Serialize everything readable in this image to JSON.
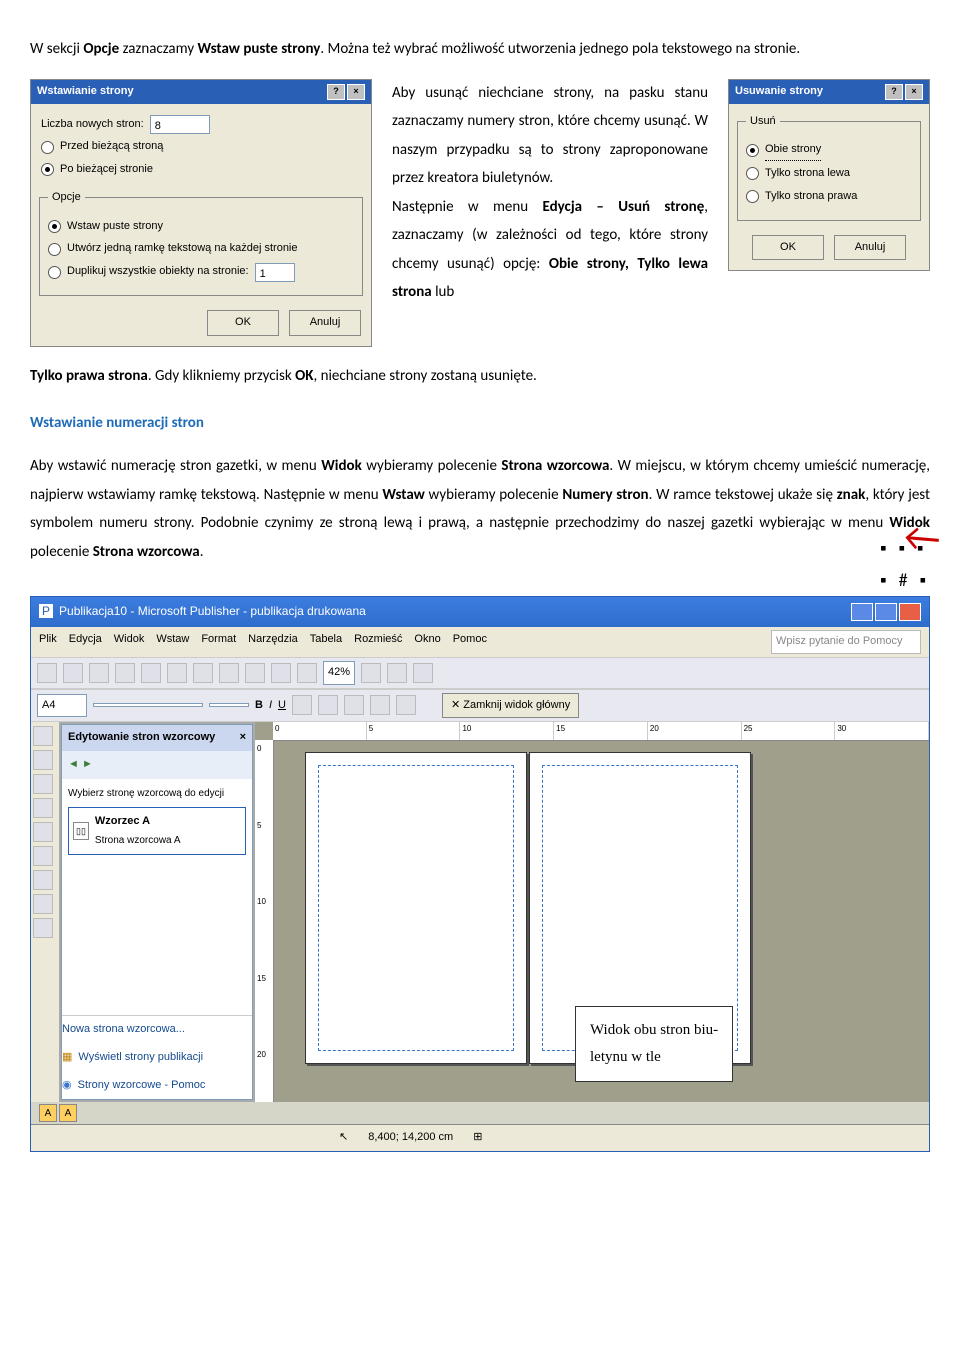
{
  "intro": {
    "p1a": "W sekcji ",
    "p1b": "Opcje",
    "p1c": " zaznaczamy ",
    "p1d": "Wstaw puste strony",
    "p1e": ". Można też wybrać możliwość utworzenia jednego pola tekstowego na stronie."
  },
  "dialog_insert": {
    "title": "Wstawianie strony",
    "field_count": "Liczba nowych stron:",
    "count_value": "8",
    "r_before": "Przed bieżącą stroną",
    "r_after": "Po bieżącej stronie",
    "opt_legend": "Opcje",
    "opt_blank": "Wstaw puste strony",
    "opt_frame": "Utwórz jedną ramkę tekstową na każdej stronie",
    "opt_dup": "Duplikuj wszystkie obiekty na stronie:",
    "dup_value": "1",
    "ok": "OK",
    "cancel": "Anuluj"
  },
  "dialog_delete": {
    "title": "Usuwanie strony",
    "legend": "Usuń",
    "r_both": "Obie strony",
    "r_left": "Tylko strona lewa",
    "r_right": "Tylko strona prawa",
    "ok": "OK",
    "cancel": "Anuluj"
  },
  "middle": {
    "t1": "Aby usunąć niechciane strony, na pasku stanu zaznaczamy numery stron, które chcemy usunąć. W naszym przypadku są to strony zaproponowane przez kreatora biuletynów.",
    "t2a": "Następnie w menu ",
    "t2b": "Edycja – Usuń stronę",
    "t2c": ", zaznaczamy (w zależności od tego, które strony chcemy usunąć) opcję: ",
    "t2d": "Obie strony, Tylko lewa strona ",
    "t2e": "lub "
  },
  "after": {
    "p1a": "Tylko prawa strona",
    "p1b": ". Gdy klikniemy przycisk ",
    "p1c": "OK",
    "p1d": ", niechciane strony zostaną usunięte."
  },
  "section2": {
    "heading": "Wstawianie numeracji stron",
    "p1a": "Aby wstawić numerację stron gazetki, w menu ",
    "p1b": "Widok",
    "p1c": " wybieramy polecenie ",
    "p1d": "Strona wzorcowa",
    "p1e": ". W miejscu, w którym chcemy umieścić numerację, najpierw wstawiamy ramkę tekstową. Następnie w menu ",
    "p1f": "Wstaw",
    "p1g": " wybieramy polecenie ",
    "p1h": "Numery stron",
    "p1i": ". W ramce tekstowej ukaże się ",
    "p1j": "znak",
    "p1k": ", który jest symbolem numeru strony. Podobnie czynimy ze stroną lewą i prawą, a następnie przechodzimy do naszej gazetki wybierając w menu ",
    "p1l": "Widok",
    "p1m": " polecenie ",
    "p1n": "Strona wzorcowa",
    "p1o": "."
  },
  "app": {
    "title": "Publikacja10 - Microsoft Publisher - publikacja drukowana",
    "menu": [
      "Plik",
      "Edycja",
      "Widok",
      "Wstaw",
      "Format",
      "Narzędzia",
      "Tabela",
      "Rozmieść",
      "Okno",
      "Pomoc"
    ],
    "search_placeholder": "Wpisz pytanie do Pomocy",
    "zoom": "42%",
    "close_master": "Zamknij widok główny",
    "pane_title": "Edytowanie stron wzorcowy",
    "pane_label": "Wybierz stronę wzorcową do edycji",
    "pane_item_title": "Wzorzec A",
    "pane_item_sub": "Strona wzorcowa A",
    "pane_new": "Nowa strona wzorcowa...",
    "pane_show": "Wyświetl strony publikacji",
    "pane_help": "Strony wzorcowe - Pomoc",
    "ruler_marks": [
      "0",
      "5",
      "10",
      "15",
      "20",
      "25",
      "30"
    ],
    "ruler_v_marks": [
      "0",
      "5",
      "10",
      "15",
      "20"
    ],
    "status_coords": "8,400; 14,200 cm",
    "tab_a": "A",
    "font_dropdown": "A4"
  },
  "callout": {
    "l1": "Widok obu stron biu-",
    "l2": "letynu w tle"
  }
}
